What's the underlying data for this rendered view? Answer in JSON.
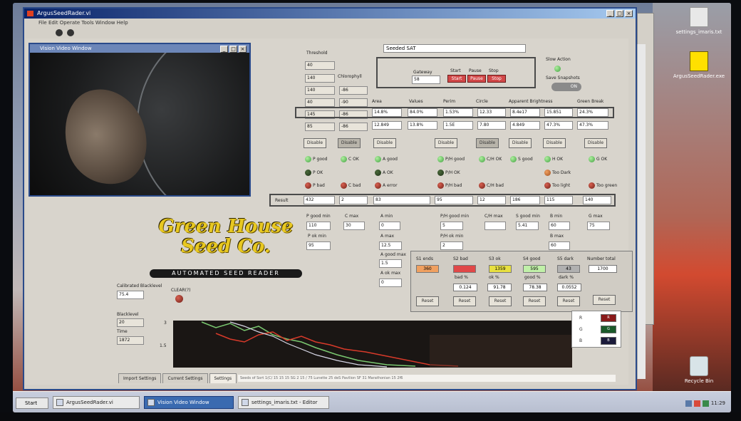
{
  "main_window": {
    "title": "ArgusSeedRader.vi",
    "menu": "File  Edit  Operate  Tools  Window  Help"
  },
  "vision_window": {
    "title": "Vision Video Window"
  },
  "top_string": "Seeded SAT",
  "gateway": {
    "gateway_label": "Gateway",
    "gateway_value": "58",
    "start_label": "Start",
    "pause_label": "Pause",
    "stop_label": "Stop",
    "start_btn": "Start",
    "pause_btn": "Pause",
    "stop_btn": "Stop"
  },
  "right_controls": {
    "slow_action_label": "Slow Action",
    "save_snapshots_label": "Save Snapshots",
    "toggle_label": "ON"
  },
  "column_headers": {
    "threshold": "Threshold",
    "chlorophyll": "Chlorophyll",
    "area": "Area",
    "values": "Values",
    "perim": "Perim",
    "circle": "Circle",
    "apparent_brightness": "Apparent Brightness",
    "green_break": "Green Break"
  },
  "threshold_values": [
    "40",
    "140",
    "140",
    "40",
    "145",
    "85"
  ],
  "chlorophyll_values": [
    "-86",
    "-90",
    "-86",
    "-86",
    "-86"
  ],
  "data_rows": [
    [
      "14.8%",
      "84.0%",
      "1.53%",
      "12.33",
      "8.4e17",
      "15.851",
      "24.3%"
    ],
    [
      "12.849",
      "13.8%",
      "1.5E",
      "7.80",
      "4.849",
      "47.3%",
      "47.3%"
    ]
  ],
  "disable_buttons": [
    "Disable",
    "Disable",
    "Disable",
    "Disable",
    "Disable",
    "Disable",
    "Disable",
    "Disable"
  ],
  "leds": {
    "row1": [
      "P good",
      "C OK",
      "A good",
      "P/H good",
      "C/H OK",
      "S good",
      "H OK",
      "G OK"
    ],
    "row2": [
      "P OK",
      "A OK",
      "P/H OK",
      "Too Dark"
    ],
    "row3": [
      "P bad",
      "C bad",
      "A error",
      "P/H bad",
      "C/H bad",
      "Too light",
      "Too green"
    ]
  },
  "result_row": {
    "label": "Result",
    "values": [
      "432",
      "2",
      "83",
      "95",
      "12",
      "186",
      "115",
      "140"
    ]
  },
  "logo": {
    "line1": "Green House",
    "line2": "Seed Co.",
    "banner": "AUTOMATED SEED READER"
  },
  "param_labels": {
    "p_good_min": "P good min",
    "c_max": "C max",
    "a_min": "A min",
    "ph_good_min": "P/H good min",
    "ch_max": "C/H max",
    "s_good_min": "S good min",
    "b_min": "B min",
    "g_max": "G max",
    "p_ok_min": "P ok min",
    "a_max": "A max",
    "ph_ok_min": "P/H ok min",
    "a_good_max": "A good max",
    "a_ok_max": "A ok max",
    "b_max": "B max"
  },
  "param_values": {
    "p_good_min": "110",
    "c_max": "30",
    "a_min": "0",
    "ph_good_min": "5",
    "ch_max": "",
    "s_good_min": "5.41",
    "b_min": "60",
    "g_max": "75",
    "p_ok_min": "95",
    "a_max": "12.5",
    "ph_ok_min": "2",
    "a_good_max": "1.5",
    "a_ok_max": "0",
    "b_max": "60"
  },
  "calibration": {
    "label": "Calibrated Blacklevel",
    "value": "75.4",
    "clear_label": "CLEAR(?)",
    "blacklevel_label": "Blacklevel",
    "blacklevel_value": "20",
    "time_label": "Time",
    "time_value": "1872"
  },
  "stats": {
    "headers": [
      "S1 ends",
      "S2 bad",
      "S3 ok",
      "S4 good",
      "S5 dark",
      "Number total"
    ],
    "values": [
      "360",
      "",
      "1359",
      "595",
      "43",
      "1700"
    ],
    "percent_labels": [
      "bad %",
      "ok %",
      "good %",
      "dark %"
    ],
    "percent_values": [
      "0.124",
      "91.78",
      "78.38",
      "0.0552"
    ],
    "reset_buttons": [
      "Reset",
      "Reset",
      "Reset",
      "Reset",
      "Reset",
      "Reset"
    ]
  },
  "legend": [
    {
      "name": "R",
      "swatch": "R"
    },
    {
      "name": "G",
      "swatch": "G"
    },
    {
      "name": "B",
      "swatch": "B"
    }
  ],
  "graph_axis": {
    "y_top": "3",
    "y_mid": "1.5"
  },
  "tabs": [
    "Import Settings",
    "Current Settings",
    "Settings"
  ],
  "tab_info": "Seeds of Sort 1(C/ 15 15 15 SG 2 15 / 75 Lunette 25 deS Pavilion SF 31 Marathonian 15 2f6",
  "desktop_icons": [
    {
      "label": "settings_imaris.txt"
    },
    {
      "label": "ArgusSeedRader.exe"
    },
    {
      "label": "Recycle Bin"
    }
  ],
  "taskbar": {
    "start": "Start",
    "buttons": [
      "ArgusSeedRader.vi",
      "Vision Video Window",
      "settings_imaris.txt - Editor"
    ],
    "clock": "11:29"
  },
  "colors": {
    "led_green": "#40a040",
    "led_red": "#702018",
    "graph_bg": "#1a1614",
    "stat_s1": "#f0a060",
    "stat_s2": "#e04848",
    "stat_s3": "#e8e040",
    "stat_s4": "#c0f0a8"
  }
}
